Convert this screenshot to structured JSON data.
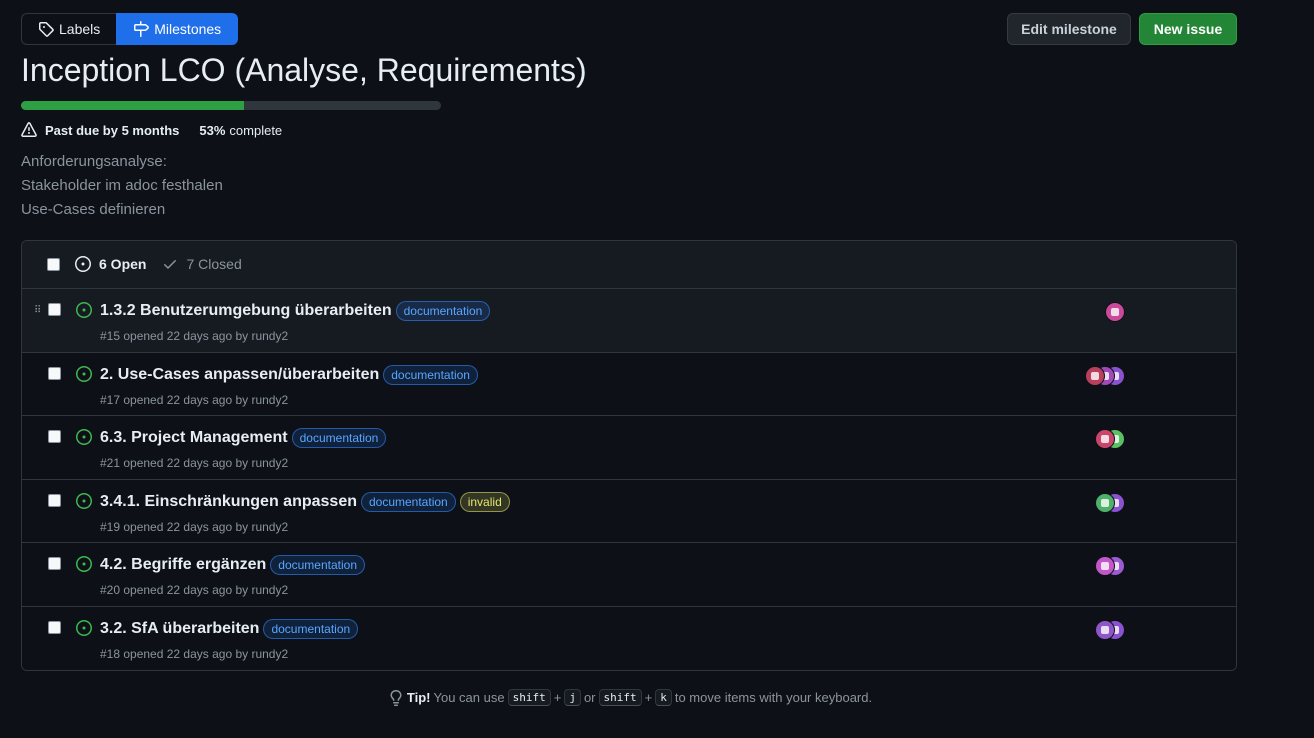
{
  "nav": {
    "labels_tab": "Labels",
    "milestones_tab": "Milestones"
  },
  "actions": {
    "edit_milestone": "Edit milestone",
    "new_issue": "New issue"
  },
  "milestone": {
    "title": "Inception LCO (Analyse, Requirements)",
    "progress_fraction": 0.53,
    "due_text": "Past due by 5 months",
    "percent_text": "53%",
    "complete_text": "complete",
    "description": [
      "Anforderungsanalyse:",
      "Stakeholder im adoc festhalen",
      "Use-Cases definieren"
    ]
  },
  "issues_header": {
    "open_label": "6 Open",
    "closed_label": "7 Closed"
  },
  "issues": [
    {
      "title": "1.3.2 Benutzerumgebung überarbeiten",
      "labels": [
        "documentation"
      ],
      "meta": "#15 opened 22 days ago by rundy2",
      "avatars": [
        "#c94a9a"
      ]
    },
    {
      "title": "2. Use-Cases anpassen/überarbeiten",
      "labels": [
        "documentation"
      ],
      "meta": "#17 opened 22 days ago by rundy2",
      "avatars": [
        "#b8405e",
        "#a04ab8",
        "#8a52d1"
      ]
    },
    {
      "title": "6.3. Project Management",
      "labels": [
        "documentation"
      ],
      "meta": "#21 opened 22 days ago by rundy2",
      "avatars": [
        "#c9456b",
        "#5bbf63"
      ]
    },
    {
      "title": "3.4.1. Einschränkungen anpassen",
      "labels": [
        "documentation",
        "invalid"
      ],
      "meta": "#19 opened 22 days ago by rundy2",
      "avatars": [
        "#4fb06a",
        "#8a52d1"
      ]
    },
    {
      "title": "4.2. Begriffe ergänzen",
      "labels": [
        "documentation"
      ],
      "meta": "#20 opened 22 days ago by rundy2",
      "avatars": [
        "#c356c9",
        "#9b5ad1"
      ]
    },
    {
      "title": "3.2. SfA überarbeiten",
      "labels": [
        "documentation"
      ],
      "meta": "#18 opened 22 days ago by rundy2",
      "avatars": [
        "#8e56c9",
        "#8a52d1"
      ]
    }
  ],
  "tip": {
    "prefix": "Tip!",
    "text1": "You can use",
    "key_shift": "shift",
    "plus": "+",
    "key_j": "j",
    "or": "or",
    "key_k": "k",
    "text2": "to move items with your keyboard."
  },
  "colors": {
    "accent": "#1f6feb",
    "success": "#238636",
    "open": "#3fb950"
  },
  "icons": {
    "labels_tab": "tag-icon",
    "milestones_tab": "milestone-icon",
    "due": "alert-icon",
    "open": "issue-opened-icon",
    "closed": "check-icon",
    "tip": "light-bulb-icon"
  }
}
